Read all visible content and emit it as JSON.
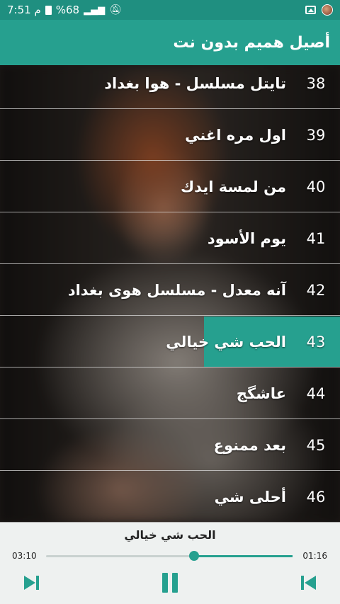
{
  "status": {
    "time": "7:51",
    "period": "م",
    "battery": "%68"
  },
  "app": {
    "title": "أصيل هميم بدون نت"
  },
  "songs": [
    {
      "num": "38",
      "title": "تايتل مسلسل - هوا بغداد"
    },
    {
      "num": "39",
      "title": "اول مره اغني"
    },
    {
      "num": "40",
      "title": "من لمسة ايدك"
    },
    {
      "num": "41",
      "title": "يوم الأسود"
    },
    {
      "num": "42",
      "title": "آنه معدل - مسلسل هوى بغداد"
    },
    {
      "num": "43",
      "title": "الحب شي خيالي",
      "active": true
    },
    {
      "num": "44",
      "title": "عاشگج"
    },
    {
      "num": "45",
      "title": "بعد ممنوع"
    },
    {
      "num": "46",
      "title": "أحلى شي"
    }
  ],
  "player": {
    "now_playing": "الحب شي خيالي",
    "elapsed": "01:16",
    "duration": "03:10",
    "progress_fraction": 0.4,
    "accent": "#26a08f",
    "icons": {
      "next": "skip-next-icon",
      "play_pause": "pause-icon",
      "prev": "skip-prev-icon"
    }
  }
}
